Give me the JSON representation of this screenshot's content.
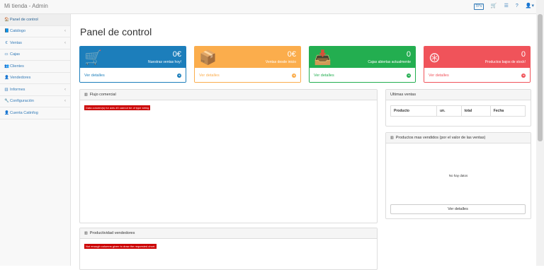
{
  "app": {
    "title": "Mi tienda - Admin"
  },
  "topbar": {
    "icons": [
      {
        "name": "tpv-icon",
        "glyph": "TPV"
      },
      {
        "name": "cart-icon",
        "glyph": "🛒"
      },
      {
        "name": "list-icon",
        "glyph": "☰"
      },
      {
        "name": "help-icon",
        "glyph": "?"
      },
      {
        "name": "user-menu-icon",
        "glyph": "👤▾"
      }
    ]
  },
  "sidebar": {
    "items": [
      {
        "label": "Panel de control",
        "icon": "🏠",
        "chevron": ""
      },
      {
        "label": "Catálogo",
        "icon": "📘",
        "chevron": "‹"
      },
      {
        "label": "Ventas",
        "icon": "€",
        "chevron": "‹"
      },
      {
        "label": "Cajas",
        "icon": "▭",
        "chevron": ""
      },
      {
        "label": "Clientes",
        "icon": "👥",
        "chevron": ""
      },
      {
        "label": "Vendedores",
        "icon": "👤",
        "chevron": ""
      },
      {
        "label": "Informes",
        "icon": "▥",
        "chevron": "‹"
      },
      {
        "label": "Configuración",
        "icon": "🔧",
        "chevron": "‹"
      },
      {
        "label": "Cuenta Catinfog",
        "icon": "👤",
        "chevron": ""
      }
    ]
  },
  "page": {
    "title": "Panel de control"
  },
  "cards": [
    {
      "value": "0€",
      "label": "Nuestras ventas hoy!",
      "link": "Ver detalles",
      "color": "#1c7ebb",
      "icon": "🛒"
    },
    {
      "value": "0€",
      "label": "Ventas desde inicio",
      "link": "Ver detalles",
      "color": "#fbad4c",
      "icon": "📦"
    },
    {
      "value": "0",
      "label": "Cajas abiertas actualmente",
      "link": "Ver detalles",
      "color": "#23ae50",
      "icon": "📥"
    },
    {
      "value": "0",
      "label": "Productos bajos de stock!",
      "link": "Ver detalles",
      "color": "#f0535a",
      "icon": "⊛"
    }
  ],
  "flujo": {
    "title": "Flujo comercial",
    "error": "Data column(s) for axis #0 cannot be of type string"
  },
  "productividad": {
    "title": "Productividad vendedores",
    "error": "Not enough columns given to draw the requested chart."
  },
  "ultimas": {
    "title": "Ultimas ventas",
    "columns": [
      "Producto",
      "un.",
      "total",
      "Fecha"
    ]
  },
  "masvendidos": {
    "title": "Productos mas vendidos (por el valor de las ventas)",
    "empty": "No hay datos",
    "button": "Ver detalles"
  }
}
